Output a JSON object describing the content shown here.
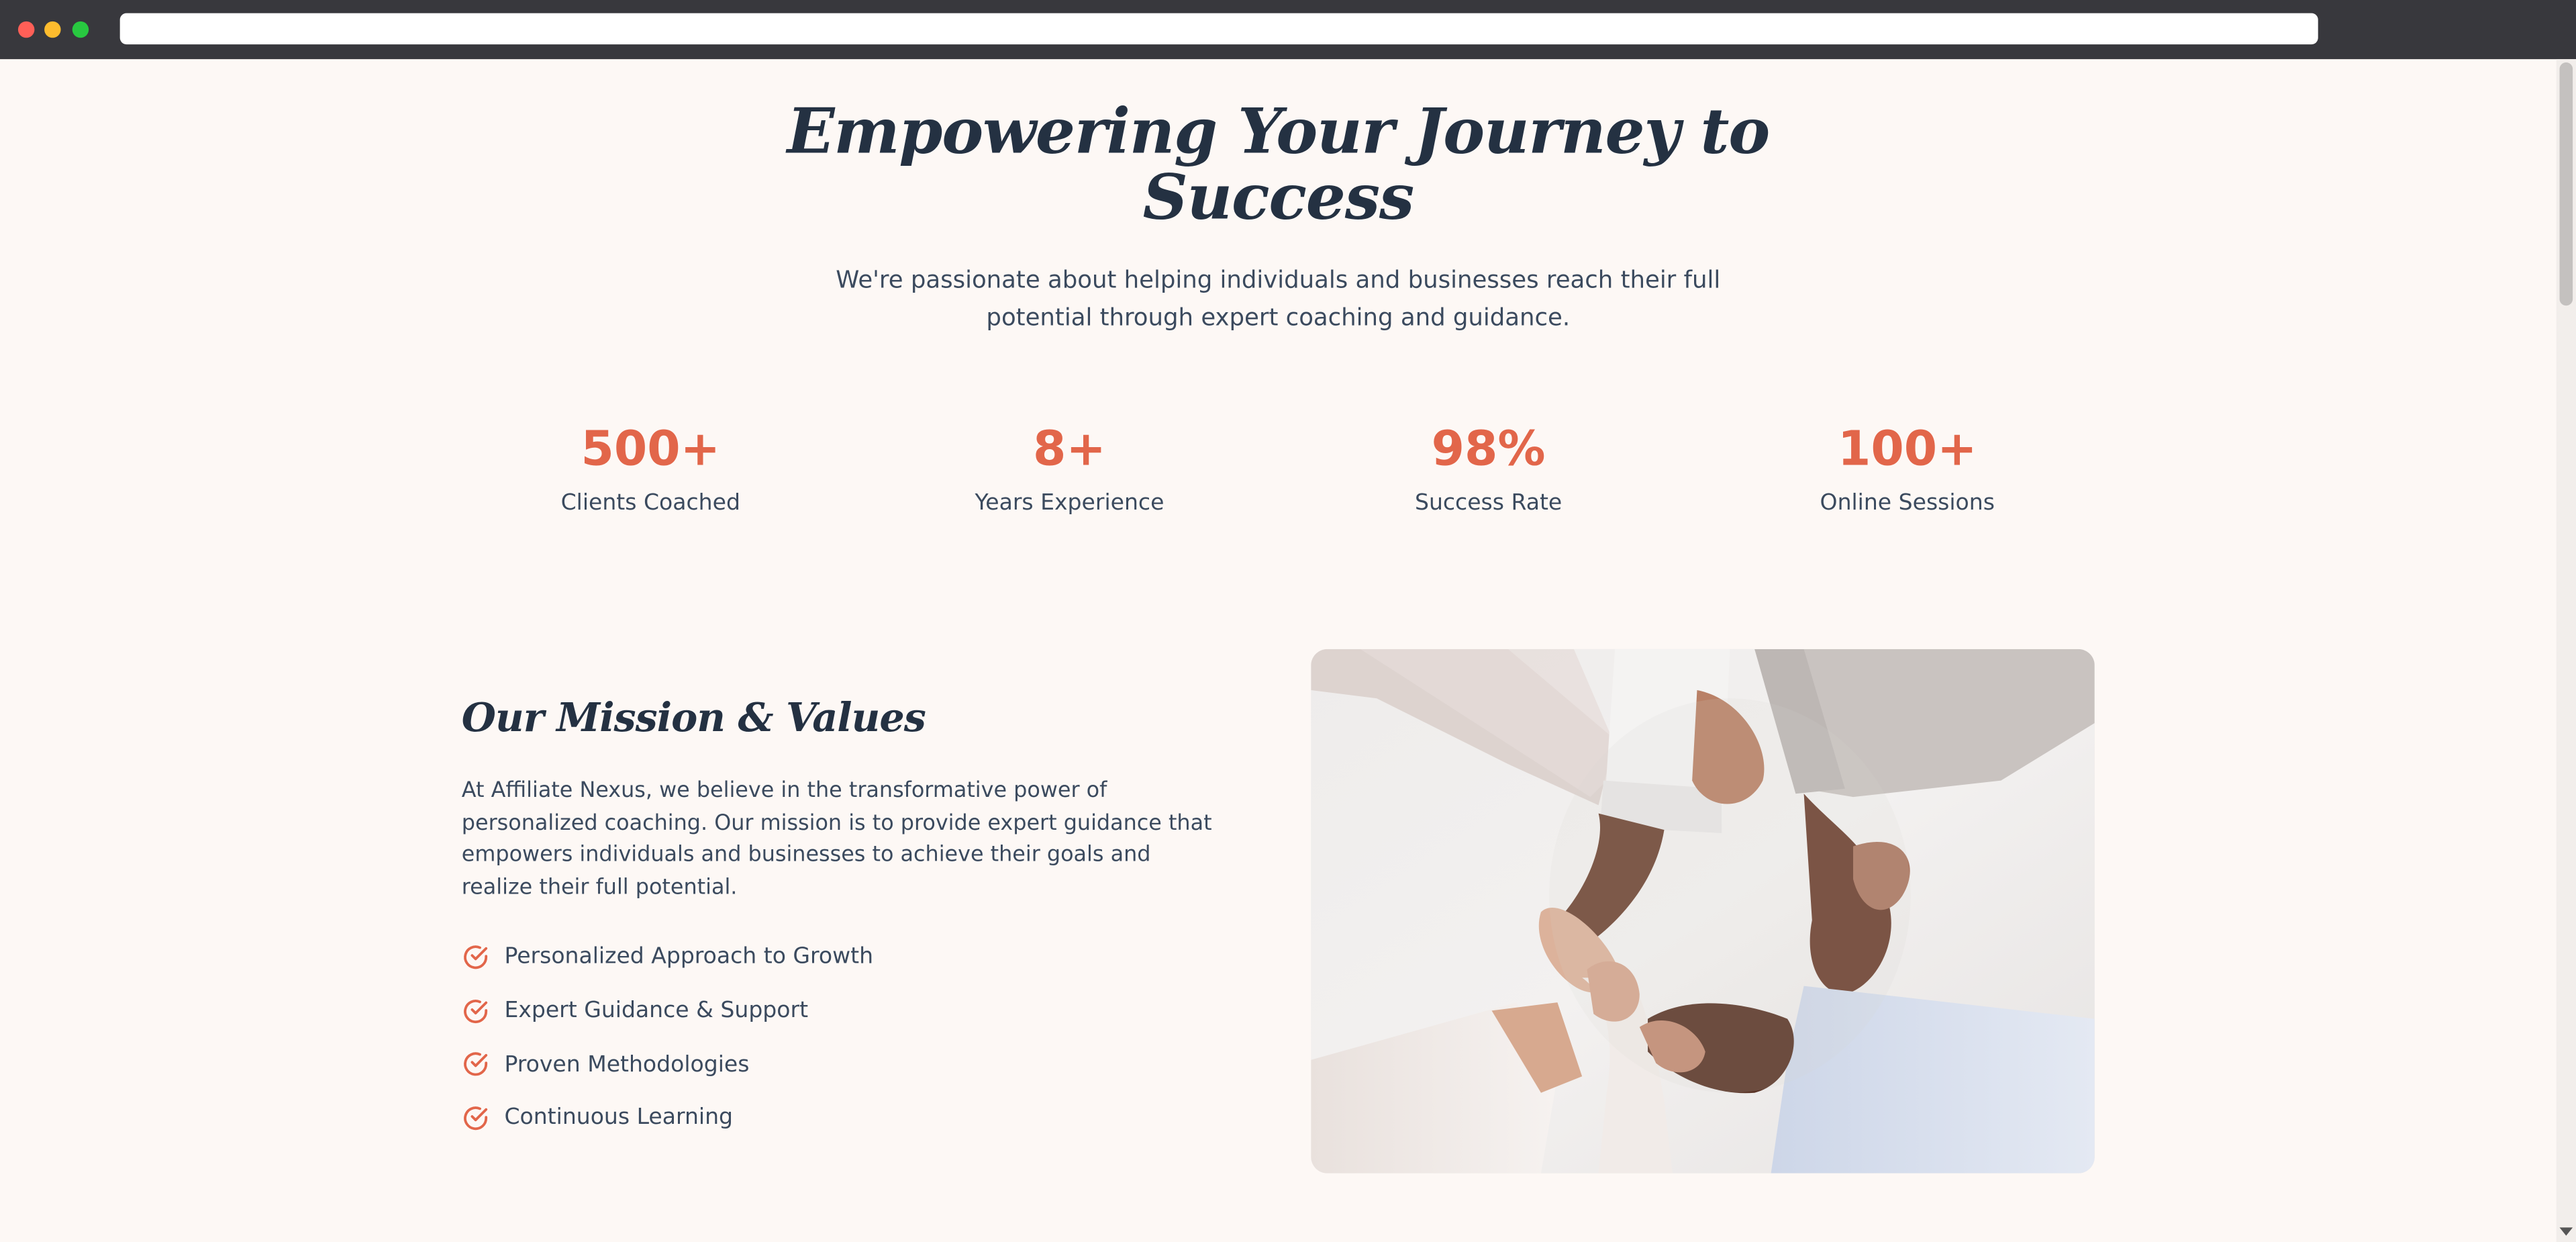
{
  "hero": {
    "title": "Empowering Your Journey to Success",
    "subtitle": "We're passionate about helping individuals and businesses reach their full potential through expert coaching and guidance."
  },
  "stats": [
    {
      "value": "500+",
      "label": "Clients Coached"
    },
    {
      "value": "8+",
      "label": "Years Experience"
    },
    {
      "value": "98%",
      "label": "Success Rate"
    },
    {
      "value": "100+",
      "label": "Online Sessions"
    }
  ],
  "mission": {
    "title": "Our Mission & Values",
    "body": "At Affiliate Nexus, we believe in the transformative power of personalized coaching. Our mission is to provide expert guidance that empowers individuals and businesses to achieve their goals and realize their full potential.",
    "values": [
      {
        "label": "Personalized Approach to Growth",
        "icon": "check-circle-icon"
      },
      {
        "label": "Expert Guidance & Support",
        "icon": "check-circle-icon"
      },
      {
        "label": "Proven Methodologies",
        "icon": "check-circle-icon"
      },
      {
        "label": "Continuous Learning",
        "icon": "check-circle-icon"
      }
    ]
  },
  "image": {
    "subject": "team-hands-joined-photo"
  },
  "colors": {
    "accent": "#e2664a",
    "heading": "#243142",
    "body_text": "#3b4a5e",
    "background": "#fdf8f5"
  }
}
